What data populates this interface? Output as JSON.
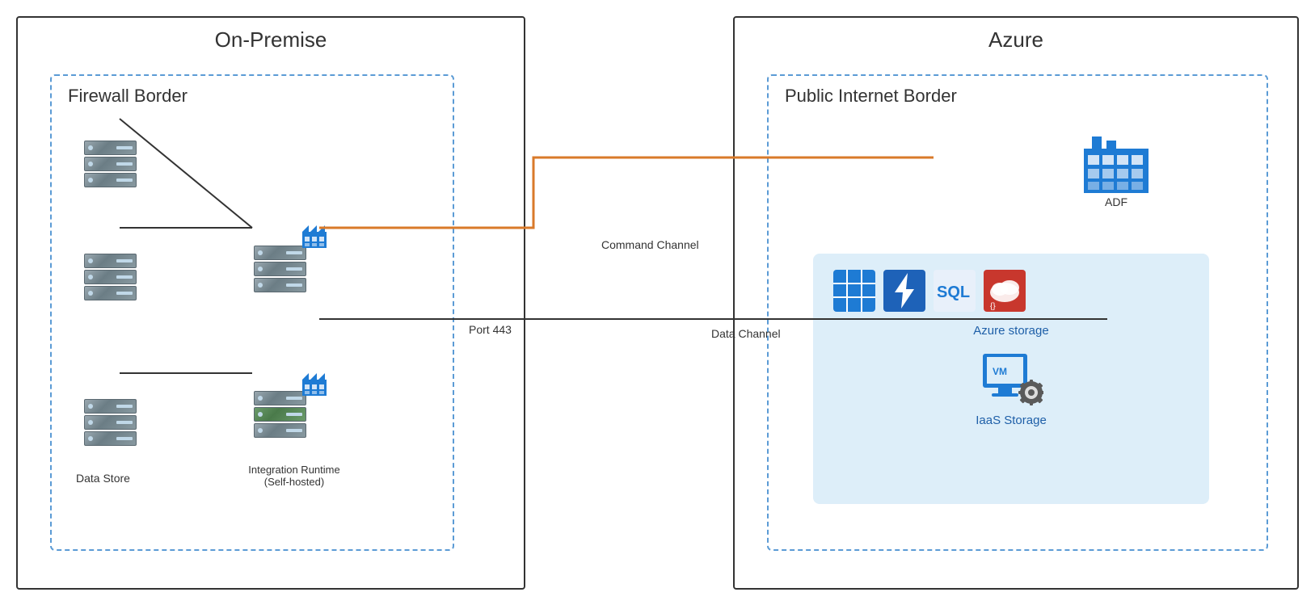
{
  "diagram": {
    "on_premise": {
      "title": "On-Premise",
      "firewall_border": {
        "label": "Firewall Border"
      },
      "data_store_label": "Data Store",
      "integration_runtime_label": "Integration Runtime\n(Self-hosted)"
    },
    "azure": {
      "title": "Azure",
      "public_internet_border": {
        "label": "Public Internet Border"
      },
      "adf_label": "ADF",
      "azure_storage_label": "Azure storage",
      "iaas_storage_label": "IaaS Storage"
    },
    "connections": {
      "command_channel_label": "Command Channel",
      "data_channel_label": "Data Channel",
      "port_label": "Port 443"
    }
  }
}
